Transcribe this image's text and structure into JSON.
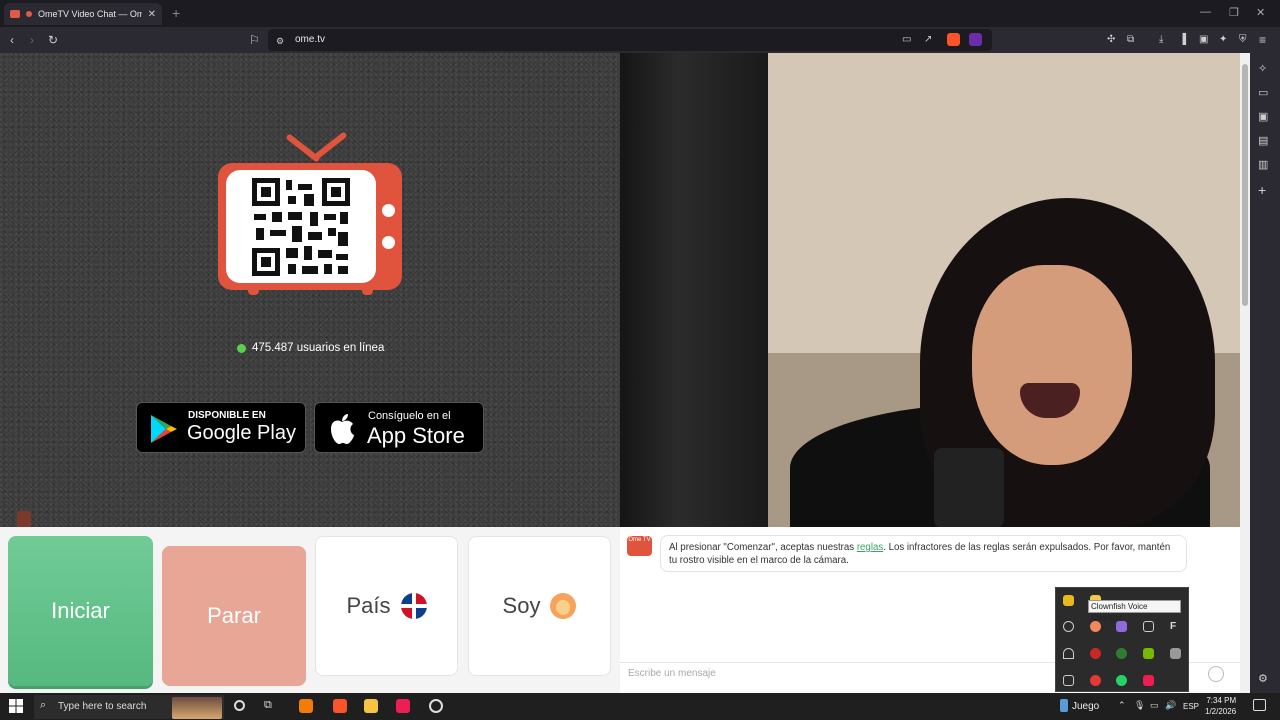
{
  "browser": {
    "tab_title": "OmeTV Video Chat — Omeg",
    "url": "ome.tv",
    "new_tab_symbol": "+",
    "window_controls": [
      "—",
      "❐",
      "✕"
    ]
  },
  "left_panel": {
    "online_text": "475.487 usuarios en línea",
    "google_play": {
      "small": "DISPONIBLE EN",
      "big": "Google Play"
    },
    "app_store": {
      "small": "Consíguelo en el",
      "big": "App Store"
    }
  },
  "controls": {
    "start": "Iniciar",
    "stop": "Parar",
    "country": "País",
    "iam": "Soy"
  },
  "chat": {
    "logo_text": "Ome TV",
    "msg_before": "Al presionar \"Comenzar\", aceptas nuestras ",
    "msg_link": "reglas",
    "msg_after": ". Los infractores de las reglas serán expulsados. Por favor, mantén tu rostro visible en el marco de la cámara.",
    "input_placeholder": "Escribe un mensaje"
  },
  "tray": {
    "tooltip": "Clownfish Voice Changer"
  },
  "taskbar": {
    "search_placeholder": "Type here to search",
    "weather": "Juego",
    "language": "ESP",
    "time": "7:34 PM",
    "date": "1/2/2026"
  },
  "colors": {
    "accent_red": "#e0533d",
    "start_green": "#5fbf86",
    "stop_pink": "#e8a696",
    "online_green": "#59d14f"
  }
}
